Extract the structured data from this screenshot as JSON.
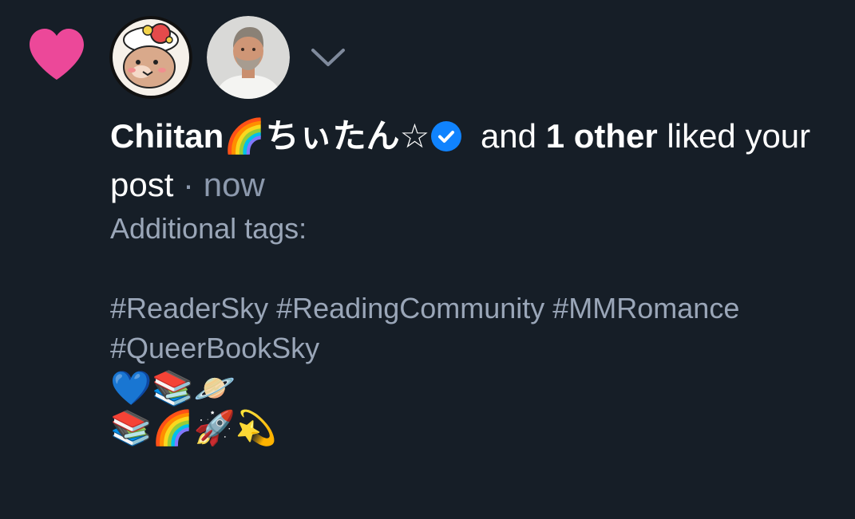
{
  "notification": {
    "type_icon": "heart-icon",
    "expand_icon": "chevron-down-icon",
    "actor_name": "Chiitan🌈ちぃたん☆",
    "verified_icon": "verified-check-icon",
    "connector": " and ",
    "others_count": "1 other",
    "action_text": " liked your post",
    "separator": " · ",
    "timestamp": "now",
    "avatars": [
      {
        "name": "Chiitan avatar"
      },
      {
        "name": "second liker avatar"
      }
    ],
    "post_text": "Additional tags:\n\n#ReaderSky #ReadingCommunity #MMRomance #QueerBookSky\n",
    "emoji_line_1": "💙📚🪐",
    "emoji_line_2": "📚🌈🚀💫"
  },
  "colors": {
    "background": "#161e27",
    "heart": "#ec4899",
    "verified": "#1083fe",
    "muted_text": "#9aa6b8"
  }
}
